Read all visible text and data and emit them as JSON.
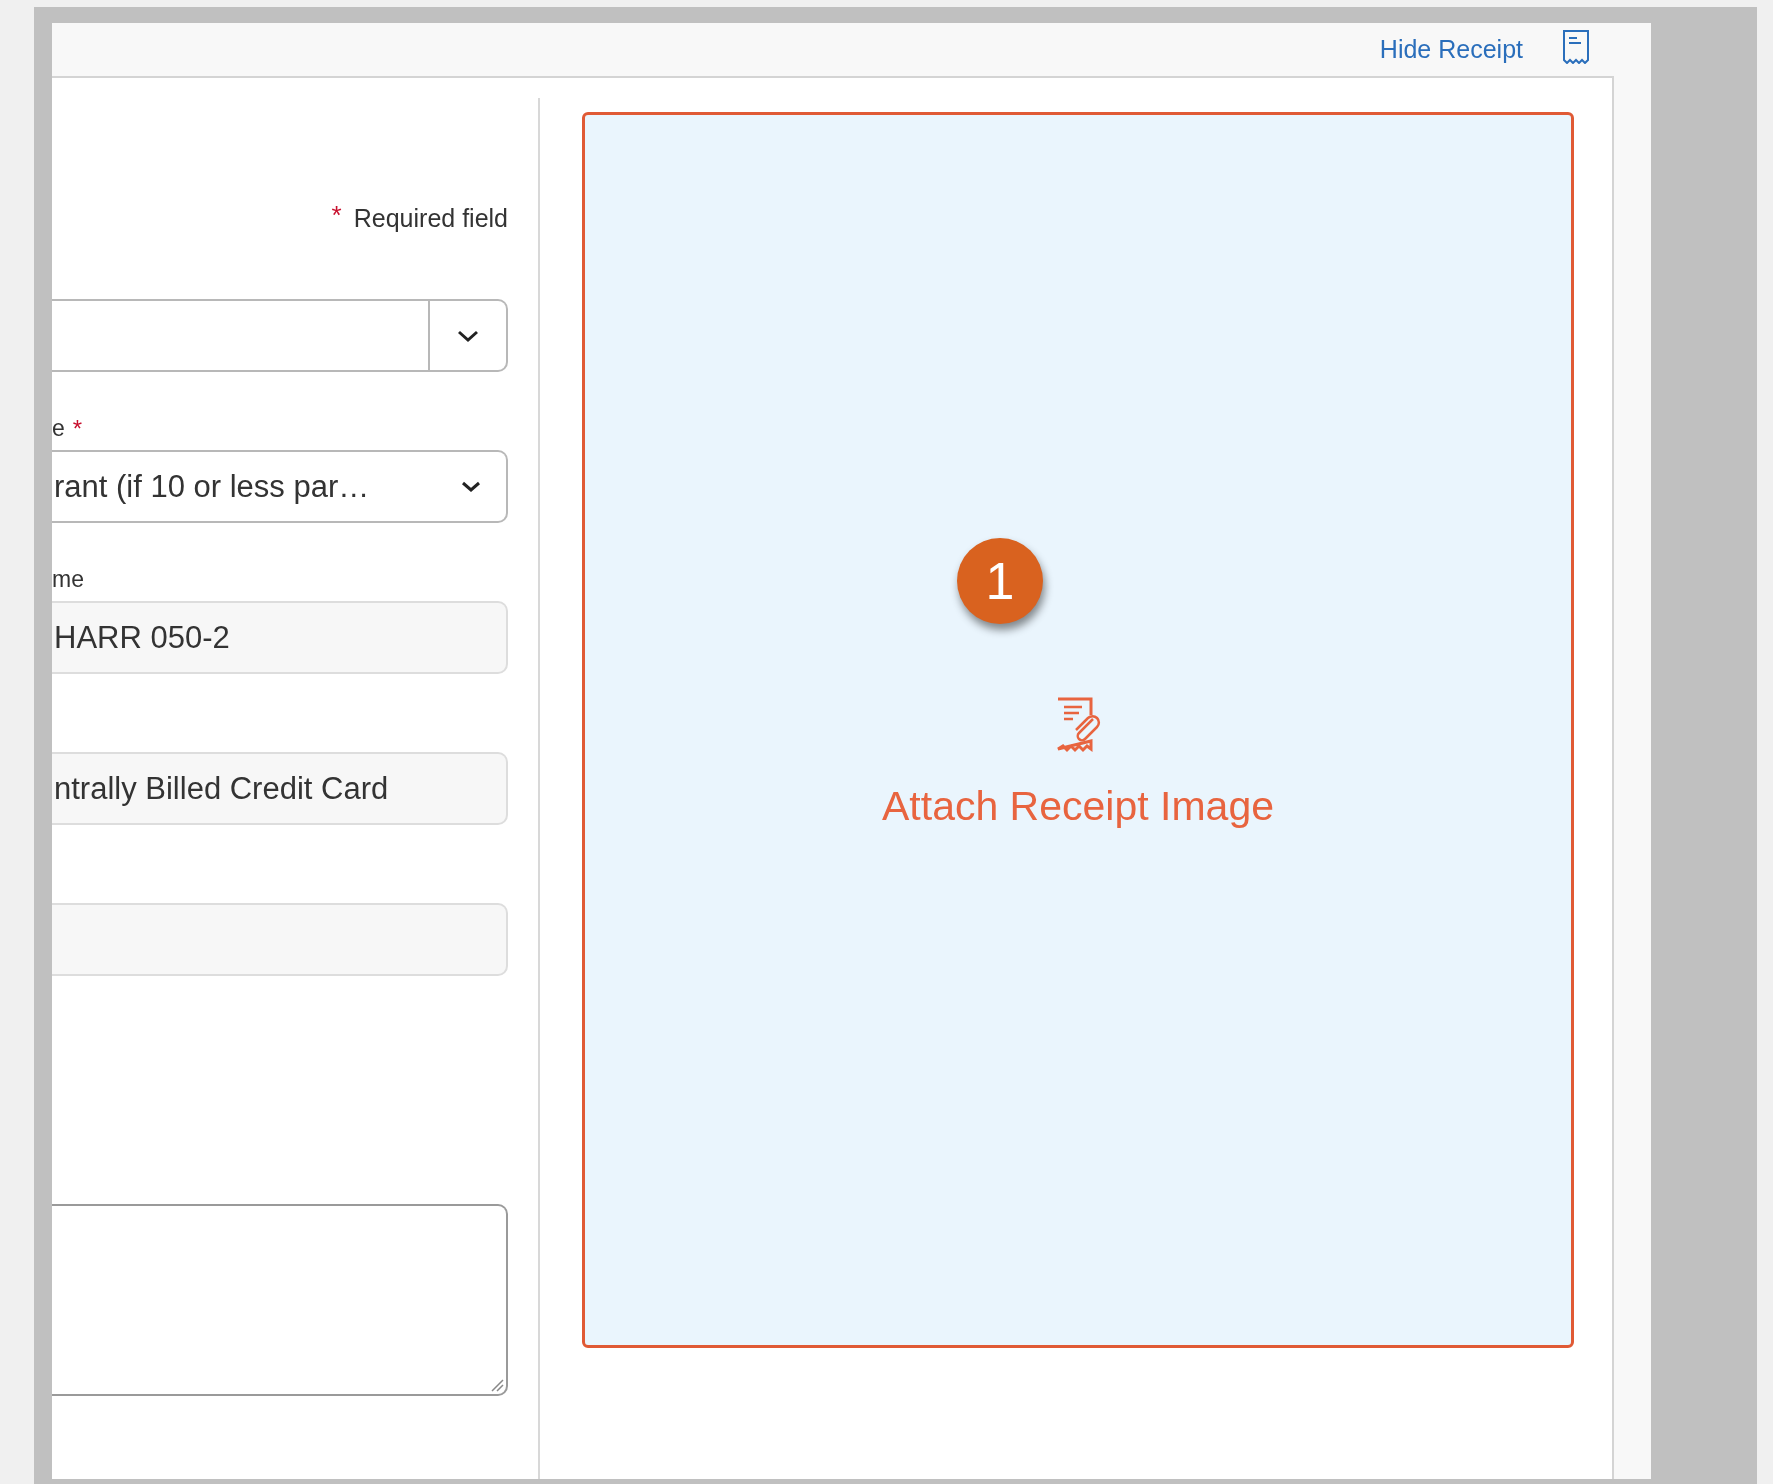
{
  "header": {
    "link": "Hide Receipt"
  },
  "required_note": {
    "marker": "*",
    "text": "Required field"
  },
  "fields": [
    {
      "kind": "combo"
    },
    {
      "kind": "select",
      "label": "e",
      "required_marker": "*",
      "value": "rant (if 10 or less par…"
    },
    {
      "kind": "readonly",
      "label": "me",
      "value": "HARR 050-2"
    },
    {
      "kind": "readonly",
      "value": "ntrally Billed Credit Card"
    },
    {
      "kind": "readonly"
    },
    {
      "kind": "textarea"
    }
  ],
  "receipt": {
    "step": "1",
    "action": "Attach Receipt Image"
  }
}
